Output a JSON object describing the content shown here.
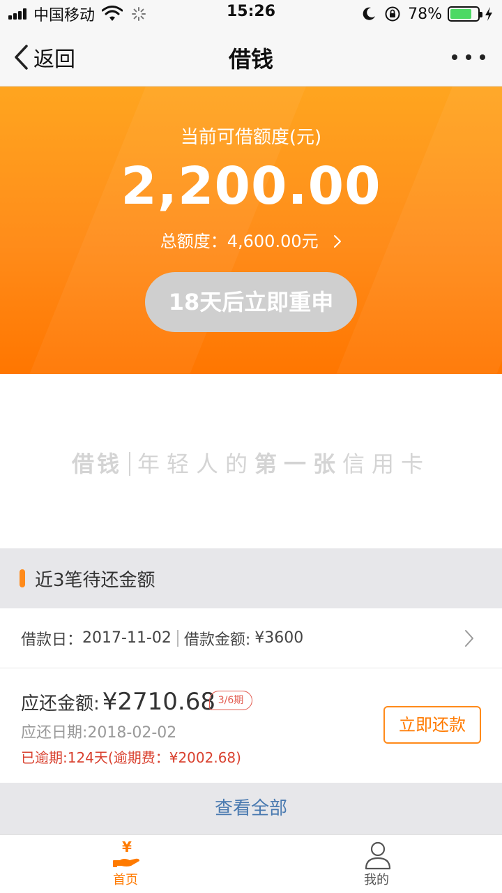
{
  "status_bar": {
    "carrier": "中国移动",
    "time": "15:26",
    "battery_percent": "78%",
    "battery_level": 0.78,
    "icons": [
      "signal-icon",
      "wifi-icon",
      "loading-spinner-icon",
      "moon-icon",
      "rotation-lock-icon",
      "battery-icon",
      "charging-bolt-icon"
    ]
  },
  "nav": {
    "back_label": "返回",
    "title": "借钱",
    "more_icon": "more-dots-icon"
  },
  "hero": {
    "label": "当前可借额度(元)",
    "amount": "2,200.00",
    "total_prefix": "总额度：",
    "total_value": "4,600.00元",
    "reapply_button": "18天后立即重申",
    "colors": {
      "gradient_top": "#ffa51f",
      "gradient_bottom": "#ff7600",
      "button_bg": "#cfcfcf"
    }
  },
  "slogan": {
    "brand": "借钱",
    "part1": "年轻人的",
    "part2": "第一张",
    "part3": "信用卡"
  },
  "section": {
    "title": "近3笔待还金额",
    "accent_color": "#ff8a1a"
  },
  "loan": {
    "date_label": "借款日：",
    "date_value": "2017-11-02",
    "amount_label": "借款金额:",
    "amount_value": "¥3600"
  },
  "repay": {
    "amount_label": "应还金额:",
    "amount_value": "¥2710.68",
    "installment": "3/6期",
    "due_date": "应还日期:2018-02-02",
    "overdue": "已逾期:124天(逾期费：¥2002.68)",
    "button": "立即还款",
    "colors": {
      "overdue": "#d9412f",
      "button": "#ff7a00"
    }
  },
  "view_all": "查看全部",
  "tabs": [
    {
      "label": "首页",
      "icon": "hand-yen-icon",
      "active": true
    },
    {
      "label": "我的",
      "icon": "user-icon",
      "active": false
    }
  ]
}
